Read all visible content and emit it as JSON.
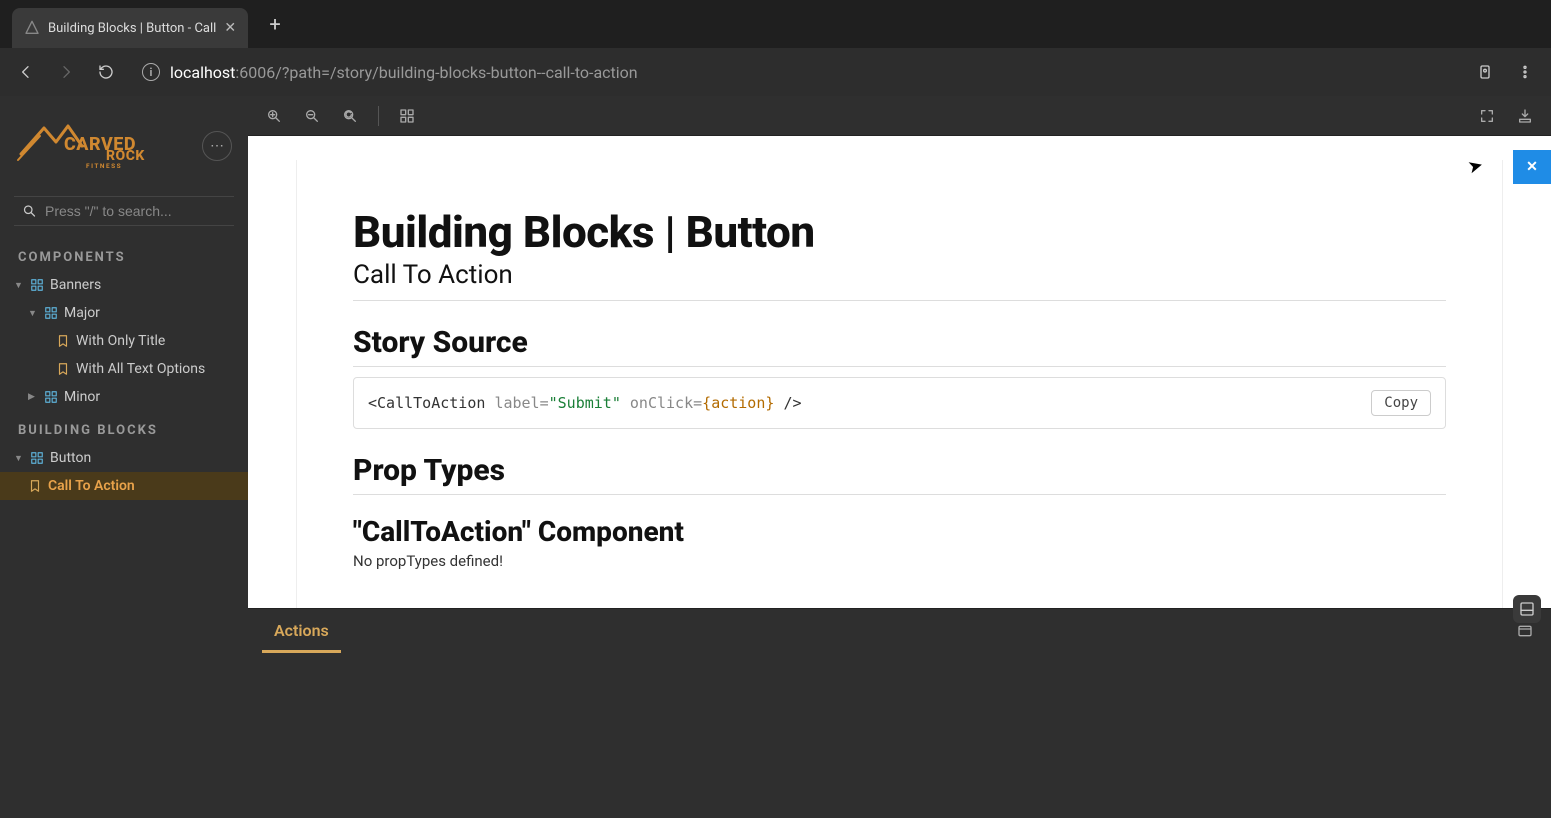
{
  "browser": {
    "tab_title": "Building Blocks | Button - Call",
    "url_host": "localhost",
    "url_port": ":6006",
    "url_path": "/?path=/story/building-blocks-button--call-to-action"
  },
  "sidebar": {
    "logo_main": "CARVED",
    "logo_sub_top": "ROCK",
    "logo_sub_bottom": "FITNESS",
    "search_placeholder": "Press \"/\" to search...",
    "section_components": "COMPONENTS",
    "components": {
      "banners": {
        "label": "Banners"
      },
      "major": {
        "label": "Major"
      },
      "with_only_title": {
        "label": "With Only Title"
      },
      "with_all_text": {
        "label": "With All Text Options"
      },
      "minor": {
        "label": "Minor"
      }
    },
    "section_blocks": "BUILDING BLOCKS",
    "blocks": {
      "button": {
        "label": "Button"
      },
      "call_to_action": {
        "label": "Call To Action"
      }
    }
  },
  "doc": {
    "title": "Building Blocks | Button",
    "subtitle": "Call To Action",
    "story_source_heading": "Story Source",
    "code": {
      "open": "<",
      "tag": "CallToAction",
      "space1": " ",
      "attr_label": "label",
      "eq1": "=",
      "q1": "\"",
      "val_label": "Submit",
      "q2": "\"",
      "space2": " ",
      "attr_onclick": "onClick",
      "eq2": "=",
      "lbrace": "{",
      "var_action": "action",
      "rbrace": "}",
      "space3": " ",
      "selfclose": "/>"
    },
    "copy_label": "Copy",
    "prop_types_heading": "Prop Types",
    "component_heading": "\"CallToAction\" Component",
    "no_prop_text": "No propTypes defined!"
  },
  "panel": {
    "close_label": "✕",
    "addon_tab_actions": "Actions"
  }
}
